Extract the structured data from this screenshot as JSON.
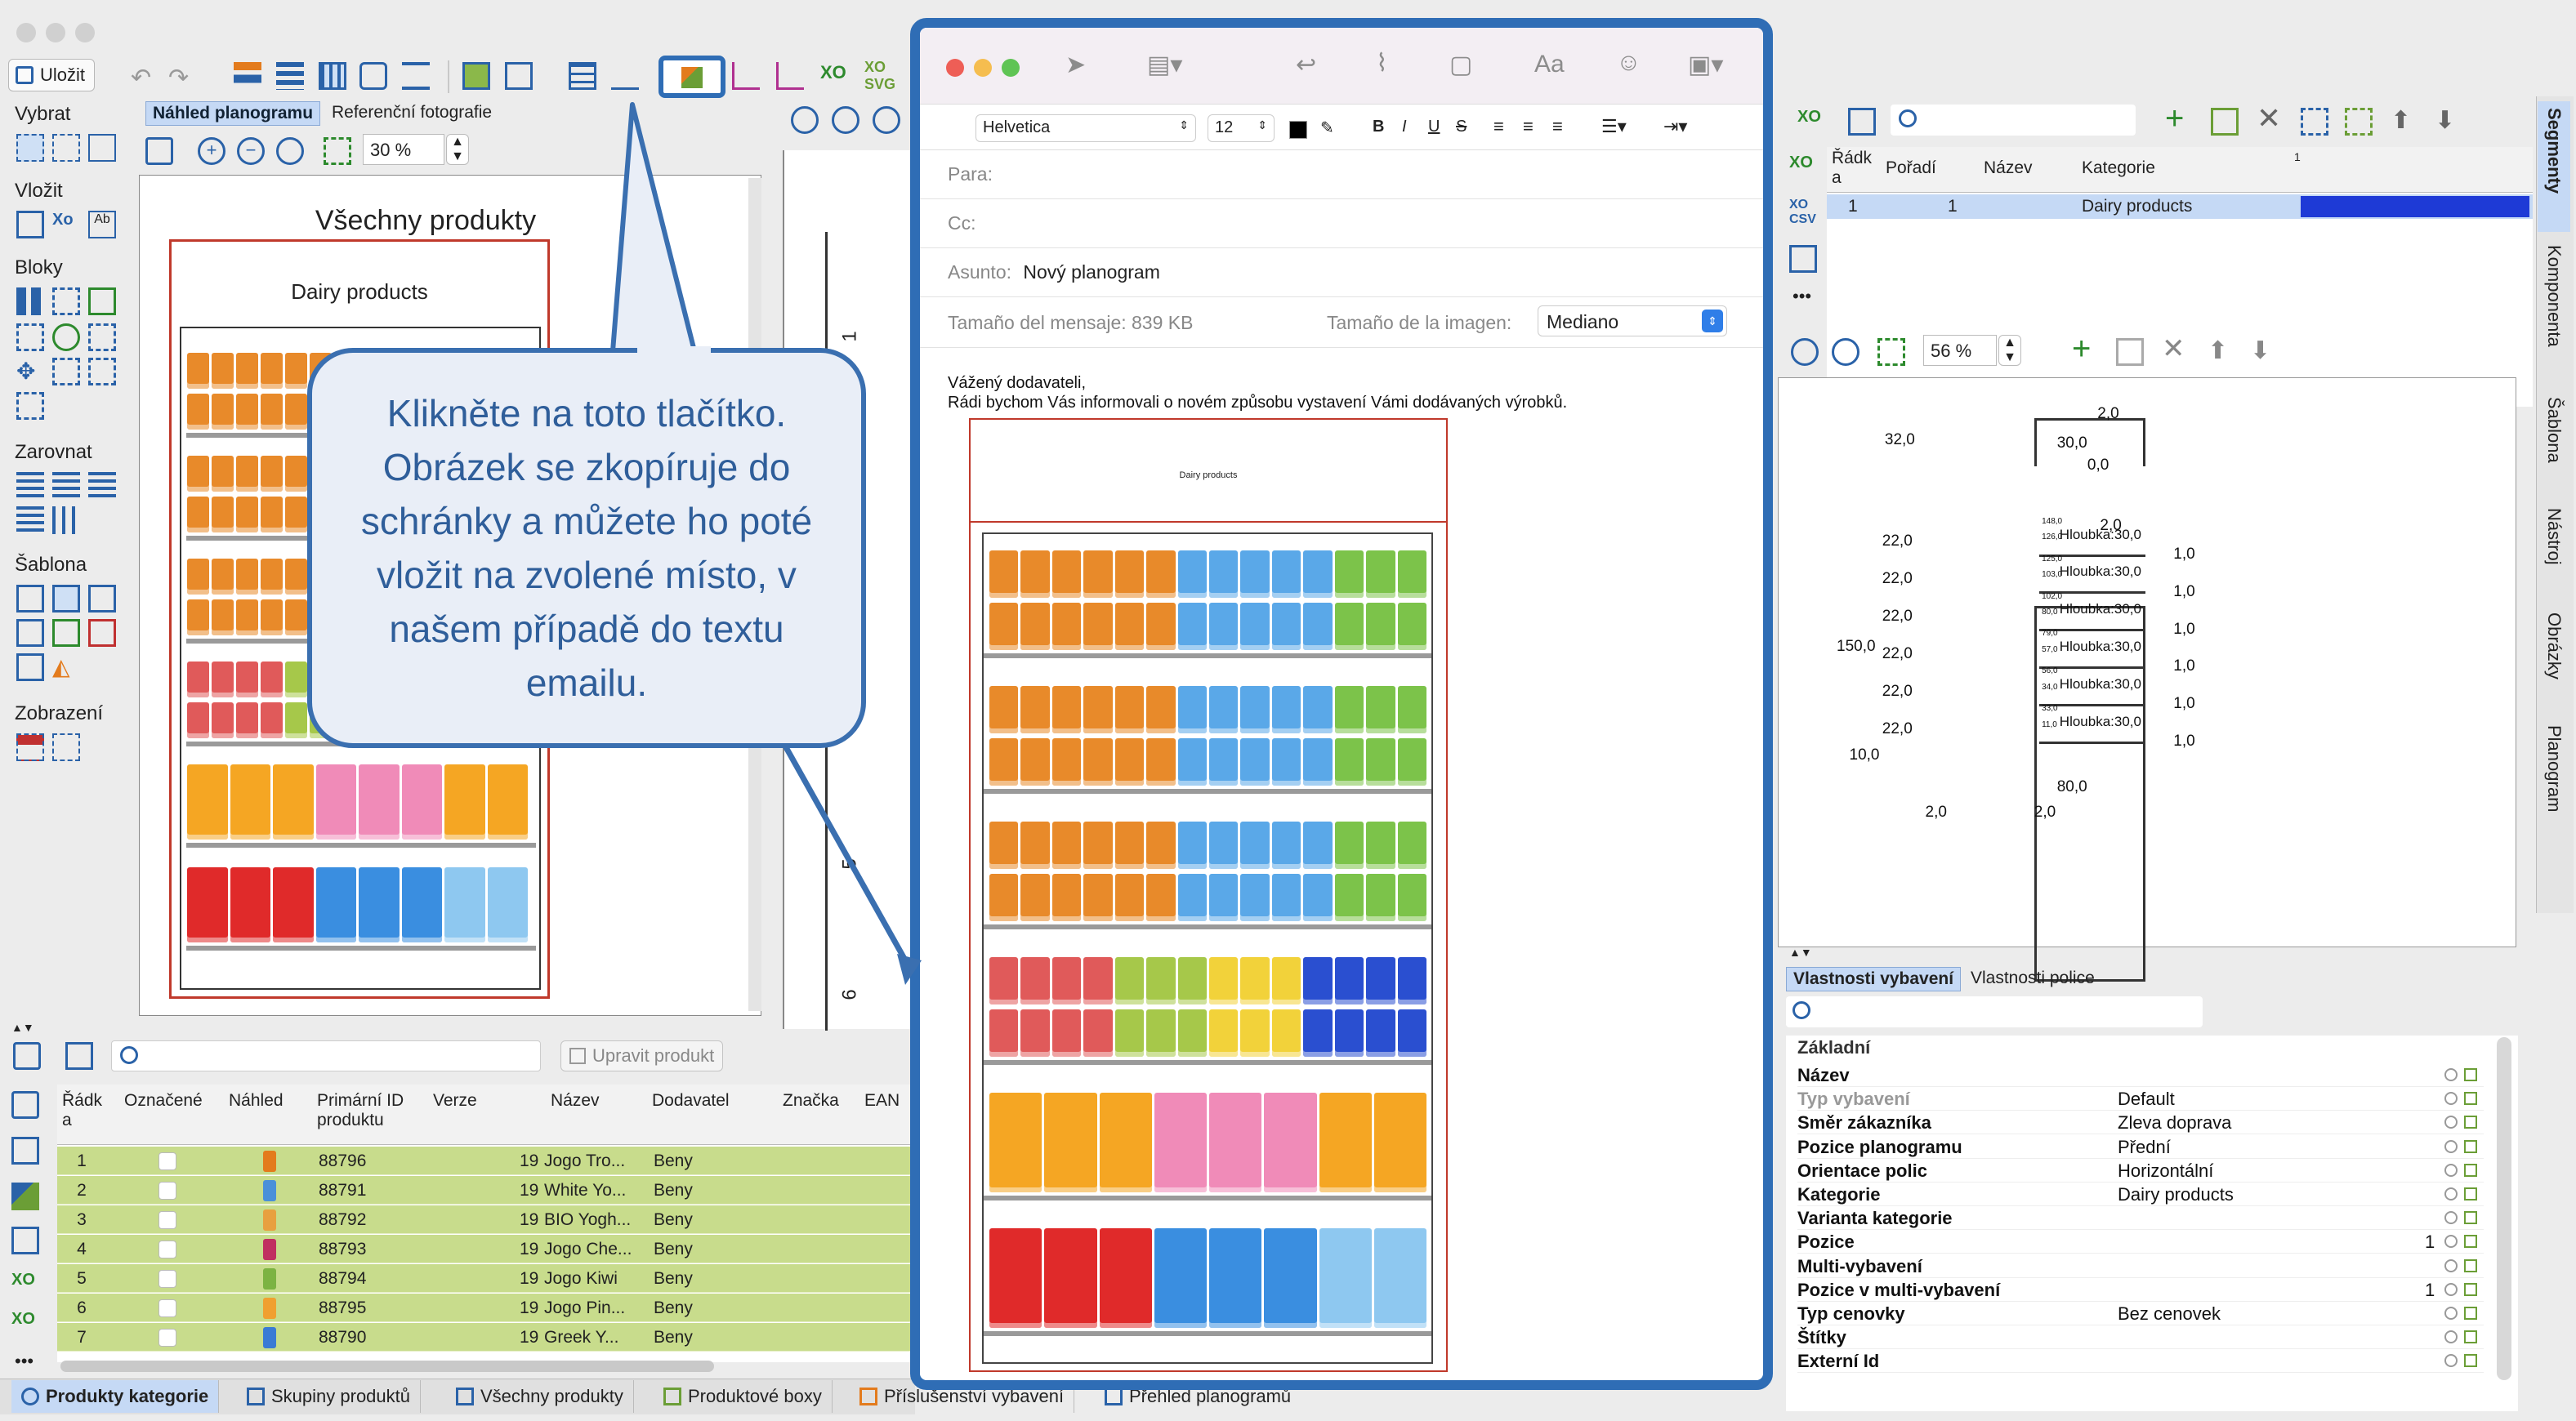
{
  "toolbar": {
    "save_label": "Uložit"
  },
  "left_panel": {
    "sections": [
      "Vybrat",
      "Vložit",
      "Bloky",
      "Zarovnat",
      "Šablona",
      "Zobrazení"
    ]
  },
  "preview": {
    "tabs": [
      "Náhled planogramu",
      "Referenční fotografie"
    ],
    "zoom": "30 %",
    "title": "Všechny produkty",
    "category": "Dairy products"
  },
  "callout": {
    "text": "Klikněte na toto tlačítko. Obrázek se zkopíruje do schránky a můžete ho poté vložit na zvolené místo, v našem případě do textu emailu."
  },
  "shelf_numbers": [
    "1",
    "5",
    "6"
  ],
  "mail": {
    "font": "Helvetica",
    "font_size": "12",
    "to_label": "Para:",
    "cc_label": "Cc:",
    "subject_label": "Asunto:",
    "subject": "Nový planogram",
    "size_label": "Tamaño del mensaje: 839 KB",
    "image_size_label": "Tamaño de la imagen:",
    "image_size": "Mediano",
    "greeting": "Vážený dodavateli,",
    "body": "Rádi bychom Vás informovali o novém způsobu vystavení Vámi dodávaných výrobků.",
    "image_title": "Dairy products"
  },
  "product_table": {
    "search_placeholder": "",
    "edit_button": "Upravit produkt",
    "columns": [
      "Řádk a",
      "Označené",
      "Náhled",
      "Primární ID produktu",
      "Verze",
      "Název",
      "Dodavatel",
      "Značka",
      "EAN"
    ],
    "rows": [
      {
        "n": "1",
        "id": "88796",
        "ver": "19",
        "name": "Jogo Tro...",
        "sup": "Beny"
      },
      {
        "n": "2",
        "id": "88791",
        "ver": "19",
        "name": "White Yo...",
        "sup": "Beny"
      },
      {
        "n": "3",
        "id": "88792",
        "ver": "19",
        "name": "BIO Yogh...",
        "sup": "Beny"
      },
      {
        "n": "4",
        "id": "88793",
        "ver": "19",
        "name": "Jogo Che...",
        "sup": "Beny"
      },
      {
        "n": "5",
        "id": "88794",
        "ver": "19",
        "name": "Jogo Kiwi",
        "sup": "Beny"
      },
      {
        "n": "6",
        "id": "88795",
        "ver": "19",
        "name": "Jogo Pin...",
        "sup": "Beny"
      },
      {
        "n": "7",
        "id": "88790",
        "ver": "19",
        "name": "Greek Y...",
        "sup": "Beny"
      }
    ]
  },
  "bottom_tabs": [
    "Produkty kategorie",
    "Skupiny produktů",
    "Všechny produkty",
    "Produktové boxy",
    "Příslušenství vybavení",
    "Přehled planogramů"
  ],
  "segments": {
    "columns": [
      "Řádk a",
      "Pořadí",
      "Název",
      "Kategorie"
    ],
    "sort_indicator": "1",
    "row": {
      "n": "1",
      "order": "1",
      "name": "",
      "category": "Dairy products"
    },
    "zoom": "56 %"
  },
  "dimensions": {
    "top": [
      "2,0",
      "32,0",
      "30,0",
      "0,0",
      "2,0"
    ],
    "left": [
      "22,0",
      "22,0",
      "22,0",
      "22,0",
      "22,0",
      "22,0"
    ],
    "total": "150,0",
    "bottom_left": "10,0",
    "shelves": [
      {
        "a": "148,0",
        "b": "126,0",
        "d": "Hloubka:30,0",
        "r": "1,0"
      },
      {
        "a": "125,0",
        "b": "103,0",
        "d": "Hloubka:30,0",
        "r": "1,0"
      },
      {
        "a": "102,0",
        "b": "80,0",
        "d": "Hloubka:30,0",
        "r": "1,0"
      },
      {
        "a": "79,0",
        "b": "57,0",
        "d": "Hloubka:30,0",
        "r": "1,0"
      },
      {
        "a": "56,0",
        "b": "34,0",
        "d": "Hloubka:30,0",
        "r": "1,0"
      },
      {
        "a": "33,0",
        "b": "11,0",
        "d": "Hloubka:30,0",
        "r": "1,0"
      }
    ],
    "width": "80,0",
    "side_left": "2,0",
    "side_right": "2,0"
  },
  "properties": {
    "tabs": [
      "Vlastnosti vybavení",
      "Vlastnosti police"
    ],
    "group": "Základní",
    "rows": [
      {
        "k": "Název",
        "v": "",
        "n": ""
      },
      {
        "k": "Typ vybavení",
        "v": "Default",
        "n": ""
      },
      {
        "k": "Směr zákazníka",
        "v": "Zleva doprava",
        "n": ""
      },
      {
        "k": "Pozice planogramu",
        "v": "Přední",
        "n": ""
      },
      {
        "k": "Orientace polic",
        "v": "Horizontální",
        "n": ""
      },
      {
        "k": "Kategorie",
        "v": "Dairy products",
        "n": ""
      },
      {
        "k": "Varianta kategorie",
        "v": "",
        "n": ""
      },
      {
        "k": "Pozice",
        "v": "",
        "n": "1"
      },
      {
        "k": "Multi-vybavení",
        "v": "",
        "n": ""
      },
      {
        "k": "Pozice v multi-vybavení",
        "v": "",
        "n": "1"
      },
      {
        "k": "Typ cenovky",
        "v": "Bez cenovek",
        "n": ""
      },
      {
        "k": "Štítky",
        "v": "",
        "n": ""
      },
      {
        "k": "Externí Id",
        "v": "",
        "n": ""
      }
    ]
  },
  "side_tabs": [
    "Segmenty",
    "Komponenta",
    "Šablona",
    "Nástroj",
    "Obrázky",
    "Planogram"
  ],
  "colors": {
    "accent": "#3a6fb0",
    "callout_bg": "#e9eef7",
    "row_green": "#c8dc8c",
    "highlight": "#1e3ad6"
  }
}
